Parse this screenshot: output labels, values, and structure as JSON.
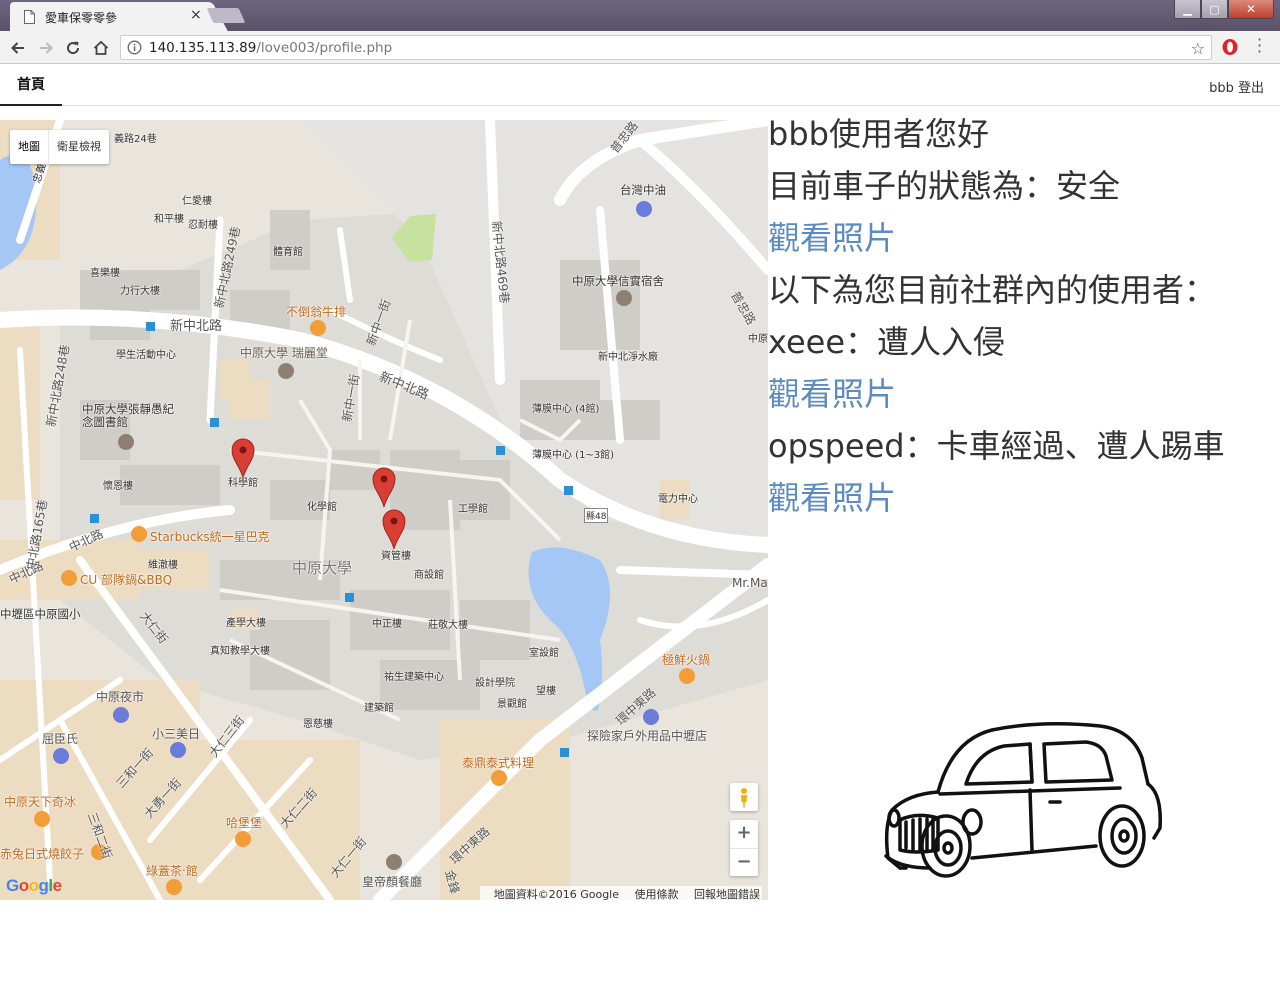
{
  "browser": {
    "tab_title": "愛車保零零參",
    "tab_close": "×",
    "url_host": "140.135.113.89",
    "url_path": "/love003/profile.php",
    "window_controls": {
      "minimize": "▁",
      "restore": "▢",
      "close": "✕"
    }
  },
  "nav": {
    "home": "首頁",
    "user_logout": "bbb 登出"
  },
  "map": {
    "type_map": "地圖",
    "type_satellite": "衛星檢視",
    "zoom_in": "+",
    "zoom_out": "−",
    "logo": "Google",
    "footer": {
      "data": "地圖資料©2016 Google",
      "terms": "使用條款",
      "report": "回報地圖錯誤"
    },
    "labels": {
      "l1": "義路24巷",
      "l2": "忠義路23巷",
      "l3": "仁愛樓",
      "l4": "和平樓",
      "l5": "忍耐樓",
      "l6": "體育館",
      "l7": "喜樂樓",
      "l8": "力行大樓",
      "l9": "新中北路249巷",
      "l10": "不倒翁牛排",
      "l11": "新中北路",
      "l12": "學生活動中心",
      "l13": "中原大學 瑞麗堂",
      "l14": "新中一街",
      "l15": "新中北路248巷",
      "l16": "中原大學張靜愚紀念圖書館",
      "l17": "科學館",
      "l18": "懷恩樓",
      "l19": "化學館",
      "l20": "新中北路469巷",
      "l21": "台灣中油",
      "l22": "中原大學信實宿舍",
      "l23": "新中北淨水廠",
      "l24": "薄膜中心 (4館)",
      "l25": "薄膜中心 (1~3館)",
      "l26": "電力中心",
      "l27": "工學館",
      "l28": "資管樓",
      "l29": "Starbucks統一星巴克",
      "l30": "維澈樓",
      "l31": "CU 部隊鍋&BBQ",
      "l32": "中原大學",
      "l33": "商設館",
      "l34": "中壢區中原國小",
      "l35": "產學大樓",
      "l36": "真知教學大樓",
      "l37": "中正樓",
      "l38": "莊敬大樓",
      "l39": "室設館",
      "l40": "祐生建築中心",
      "l41": "設計學院",
      "l42": "景觀館",
      "l43": "建築館",
      "l44": "恩慈樓",
      "l45": "中原夜市",
      "l46": "小三美日",
      "l47": "屈臣氏",
      "l48": "中原天下奇冰",
      "l49": "哈堡堡",
      "l50": "赤兔日式燒餃子",
      "l51": "綠蓋茶‧館",
      "l52": "皇帝顏餐廳",
      "l53": "泰鼎泰式料理",
      "l54": "極鮮火鍋",
      "l55": "探險家戶外用品中壢店",
      "l56": "環中東路",
      "l57": "Mr.Ma",
      "l58": "大仁街",
      "l59": "大仁二街",
      "l60": "三和一街",
      "l61": "三和二街",
      "l62": "大勇一街",
      "l63": "大仁一街",
      "l64": "中北路",
      "l65": "中北路165巷",
      "l66": "新中北路",
      "l67": "普忠路",
      "l68": "望樓",
      "l69": "環中東路",
      "l70": "縣48",
      "l71": "新中一街",
      "l72": "大仁三街",
      "l73": "中北路",
      "l74": "普忠路",
      "l75": "中原",
      "l76": "金鋒"
    }
  },
  "panel": {
    "greeting": "bbb使用者您好",
    "status": "目前車子的狀態為：安全",
    "view_photo_1": "觀看照片",
    "community_header": "以下為您目前社群內的使用者：",
    "user1": "xeee：遭人入侵",
    "view_photo_2": "觀看照片",
    "user2": "opspeed：卡車經過、遭人踢車",
    "view_photo_3": "觀看照片"
  },
  "colors": {
    "link": "#5b8bbf",
    "text": "#333333",
    "pin": "#d93d34",
    "water": "#a4c7f5",
    "park": "#c9e2a6",
    "campus": "#dcdad4"
  },
  "icons": {
    "back": "arrow-left-icon",
    "forward": "arrow-right-icon",
    "reload": "reload-icon",
    "home": "home-icon",
    "info": "info-icon",
    "bookmark": "star-icon",
    "opera": "opera-icon",
    "menu": "kebab-menu-icon",
    "pegman": "pegman-icon",
    "car": "car-drawing-icon"
  }
}
